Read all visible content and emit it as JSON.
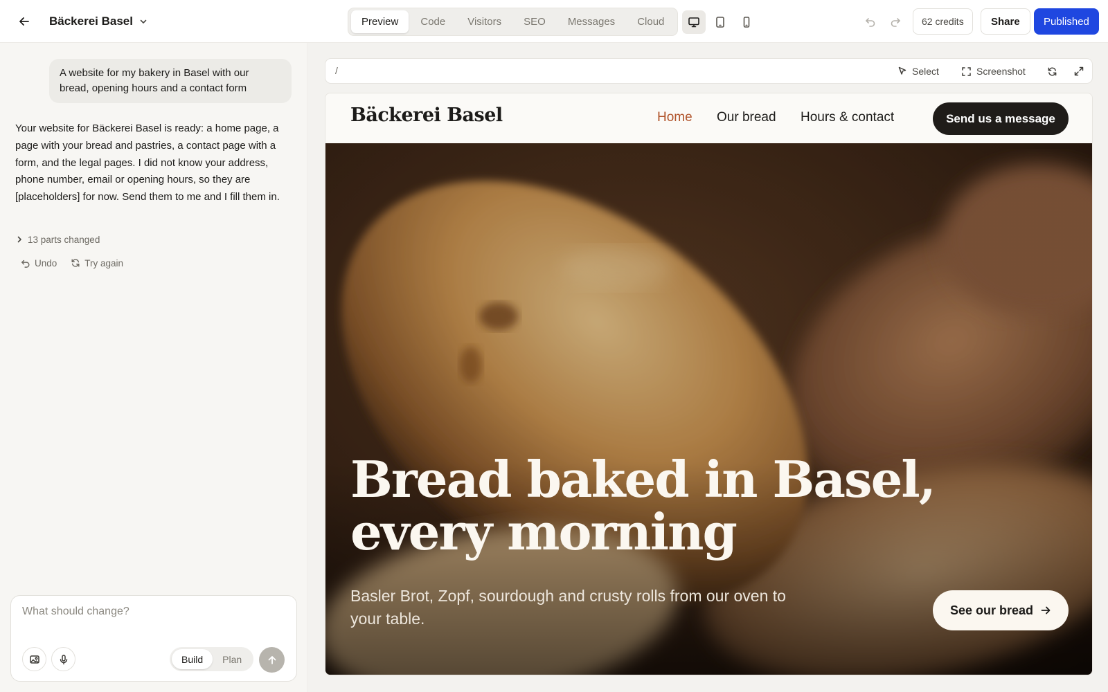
{
  "app": {
    "project_name": "Bäckerei Basel",
    "tabs": [
      {
        "label": "Preview",
        "active": true
      },
      {
        "label": "Code"
      },
      {
        "label": "Visitors"
      },
      {
        "label": "SEO"
      },
      {
        "label": "Messages"
      },
      {
        "label": "Cloud"
      }
    ],
    "devices": [
      "desktop-icon",
      "tablet-icon",
      "mobile-icon"
    ],
    "active_device": "desktop",
    "credits": "62 credits",
    "share_label": "Share",
    "publish_label": "Published",
    "accent_color": "#1f47e0"
  },
  "chat": {
    "user_message": "A website for my bakery in Basel with our bread, opening hours and a contact form",
    "assistant_message": "Your website for Bäckerei Basel is ready: a home page, a page with your bread and pastries, a contact page with a form, and the legal pages. I did not know your address, phone number, email or opening hours, so they are [placeholders] for now. Send them to me and I fill them in.",
    "changes_label": "13 parts changed",
    "undo_label": "Undo",
    "retry_label": "Try again",
    "composer": {
      "placeholder": "What should change?",
      "value": "",
      "modes": [
        {
          "label": "Build",
          "active": true
        },
        {
          "label": "Plan"
        }
      ]
    }
  },
  "preview": {
    "url_path": "/",
    "select_label": "Select",
    "screenshot_label": "Screenshot"
  },
  "site": {
    "logo": "Bäckerei Basel",
    "nav": [
      {
        "label": "Home",
        "active": true
      },
      {
        "label": "Our bread"
      },
      {
        "label": "Hours & contact"
      }
    ],
    "nav_cta": "Send us a message",
    "hero": {
      "title_line1": "Bread baked in Basel,",
      "title_line2": "every morning",
      "subtitle": "Basler Brot, Zopf, sourdough and crusty rolls from our oven to your table.",
      "cta": "See our bread"
    },
    "brand_accent": "#b0532a",
    "dark_button": "#1f1c19"
  }
}
